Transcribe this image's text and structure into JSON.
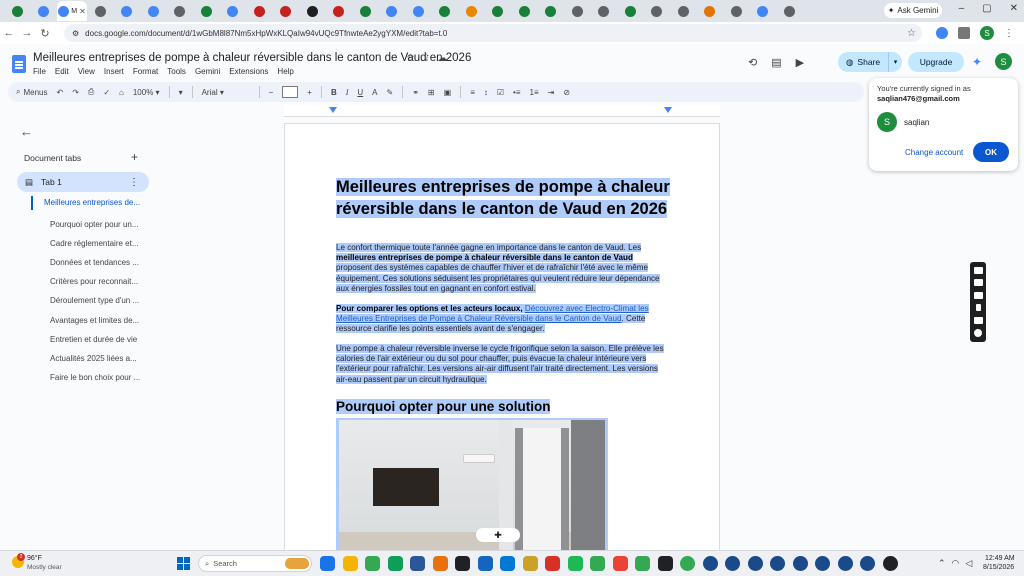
{
  "browser": {
    "active_tab_label": "M",
    "ask_gemini": "Ask Gemini",
    "url": "docs.google.com/document/d/1wGbM8l87Nm5xHpWxKLQaIw94vUQc9TfnwteAe2ygYXM/edit?tab=t.0",
    "tab_icon_colors": [
      "#188038",
      "#4285f4",
      "#4285f4",
      "#5f6368",
      "#4285f4",
      "#4285f4",
      "#5f6368",
      "#188038",
      "#4285f4",
      "#c5221f",
      "#c5221f",
      "#1f1f1f",
      "#c5221f",
      "#188038",
      "#4285f4",
      "#4285f4",
      "#188038",
      "#ea8600",
      "#188038",
      "#188038",
      "#188038",
      "#5f6368",
      "#5f6368",
      "#188038",
      "#5f6368",
      "#5f6368",
      "#e37400",
      "#5f6368",
      "#4285f4",
      "#5f6368"
    ],
    "profile_initial": "S"
  },
  "doc": {
    "title": "Meilleures entreprises de pompe à chaleur réversible dans le canton de Vaud en 2026",
    "menu": [
      "File",
      "Edit",
      "View",
      "Insert",
      "Format",
      "Tools",
      "Gemini",
      "Extensions",
      "Help"
    ],
    "share_label": "Share",
    "upgrade_label": "Upgrade",
    "avatar_initial": "S"
  },
  "toolbar": {
    "menus_label": "Menus",
    "zoom": "100%",
    "font": "Arial"
  },
  "sidebar": {
    "header": "Document tabs",
    "tab_label": "Tab 1",
    "outline": [
      {
        "level": 1,
        "label": "Meilleures entreprises de..."
      },
      {
        "level": 2,
        "label": "Pourquoi opter pour un..."
      },
      {
        "level": 2,
        "label": "Cadre réglementaire et..."
      },
      {
        "level": 2,
        "label": "Données et tendances ..."
      },
      {
        "level": 2,
        "label": "Critères pour reconnait..."
      },
      {
        "level": 2,
        "label": "Déroulement type d'un ..."
      },
      {
        "level": 2,
        "label": "Avantages et limites de..."
      },
      {
        "level": 2,
        "label": "Entretien et durée de vie"
      },
      {
        "level": 2,
        "label": "Actualités 2025 liées a..."
      },
      {
        "level": 2,
        "label": "Faire le bon choix pour ..."
      }
    ]
  },
  "page": {
    "h1": "Meilleures entreprises de pompe à chaleur réversible dans le canton de Vaud en 2026",
    "p1_a": "Le confort thermique toute l'année gagne en importance dans le canton de Vaud. Les ",
    "p1_b": "meilleures entreprises de pompe à chaleur réversible dans le canton de Vaud",
    "p1_c": " proposent des systèmes capables de chauffer l'hiver et de rafraîchir l'été avec le même équipement. Ces solutions séduisent les propriétaires qui veulent réduire leur dépendance aux énergies fossiles tout en gagnant en confort estival.",
    "p2_a": "Pour comparer les options et les acteurs locaux,",
    "p2_link": "Découvrez avec Electro-Climat les Meilleures Entreprises de Pompe à Chaleur Réversible dans le Canton de Vaud",
    "p2_c": ". Cette ressource clarifie les points essentiels avant de s'engager.",
    "p3": "Une pompe à chaleur réversible inverse le cycle frigorifique selon la saison. Elle prélève les calories de l'air extérieur ou du sol pour chauffer, puis évacue la chaleur intérieure vers l'extérieur pour rafraîchir. Les versions air-air diffusent l'air traité directement. Les versions air-eau passent par un circuit hydraulique.",
    "h2": "Pourquoi opter pour une solution réversible ?"
  },
  "account_popup": {
    "line1": "You're currently signed in as",
    "email": "saqlian476@gmail.com",
    "avatar_initial": "S",
    "name": "saqlian",
    "change": "Change account",
    "ok": "OK"
  },
  "taskbar": {
    "weather_badge": "2",
    "temp": "96°F",
    "weather": "Mostly clear",
    "search": "Search",
    "time": "12:49 AM",
    "date": "8/15/2026",
    "app_colors": [
      "#1a73e8",
      "#f4b400",
      "#34a853",
      "#0f9d58",
      "#2b579a",
      "#e8710a",
      "#202124",
      "#1565c0",
      "#0078d4",
      "#c9a227",
      "#d93025",
      "#1db954",
      "#34a853",
      "#ea4335",
      "#34a853",
      "#202124",
      "#34a853",
      "#1a4a8a",
      "#1a4a8a",
      "#1a4a8a",
      "#1a4a8a",
      "#1a4a8a",
      "#1a4a8a",
      "#1a4a8a",
      "#1a4a8a",
      "#202124"
    ]
  }
}
